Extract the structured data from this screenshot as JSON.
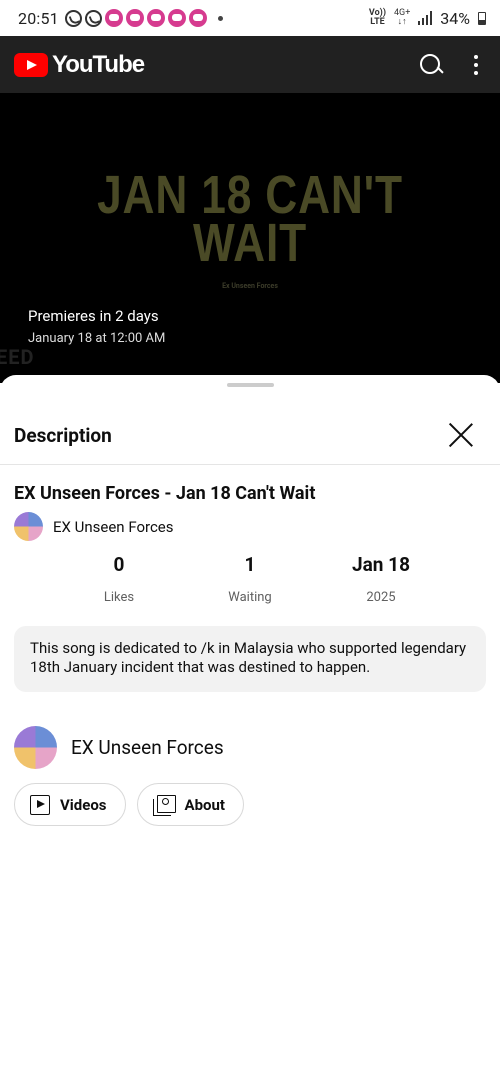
{
  "status_bar": {
    "time": "20:51",
    "volte_top": "Vo))",
    "volte_bottom": "LTE",
    "network_top": "4G+",
    "network_bottom": "↓↑",
    "battery": "34%"
  },
  "app_bar": {
    "logo_text": "YouTube",
    "brand_color": "#ff0000"
  },
  "video": {
    "thumbnail_title": "JAN 18 CAN'T WAIT",
    "thumbnail_subtitle": "Ex Unseen Forces",
    "premiere_text": "Premieres in 2 days",
    "premiere_date": "January 18 at 12:00 AM",
    "edge_text": "EED"
  },
  "description_sheet": {
    "title": "Description",
    "video_title": "EX Unseen Forces - Jan 18 Can't Wait",
    "channel_name": "EX Unseen Forces",
    "stats": [
      {
        "value": "0",
        "label": "Likes"
      },
      {
        "value": "1",
        "label": "Waiting"
      },
      {
        "value": "Jan 18",
        "label": "2025"
      }
    ],
    "description": "This song is dedicated to /k in Malaysia who supported legendary 18th January incident that was destined to happen.",
    "channel_section": {
      "name": "EX Unseen Forces",
      "buttons": [
        {
          "label": "Videos",
          "icon": "video-library-icon"
        },
        {
          "label": "About",
          "icon": "about-profile-icon"
        }
      ]
    }
  }
}
